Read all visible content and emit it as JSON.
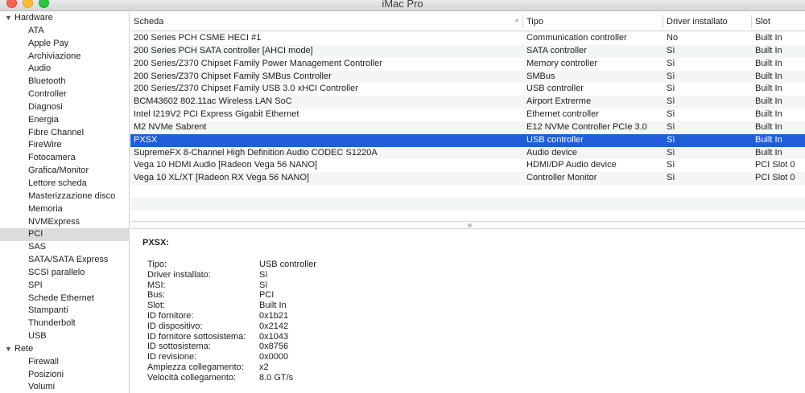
{
  "window": {
    "title": "iMac Pro"
  },
  "sidebar": {
    "groups": [
      {
        "label": "Hardware",
        "items": [
          "ATA",
          "Apple Pay",
          "Archiviazione",
          "Audio",
          "Bluetooth",
          "Controller",
          "Diagnosi",
          "Energia",
          "Fibre Channel",
          "FireWire",
          "Fotocamera",
          "Grafica/Monitor",
          "Lettore scheda",
          "Masterizzazione disco",
          "Memoria",
          "NVMExpress",
          "PCI",
          "SAS",
          "SATA/SATA Express",
          "SCSI parallelo",
          "SPI",
          "Schede Ethernet",
          "Stampanti",
          "Thunderbolt",
          "USB"
        ]
      },
      {
        "label": "Rete",
        "items": [
          "Firewall",
          "Posizioni",
          "Volumi"
        ]
      }
    ],
    "selected": "PCI"
  },
  "table": {
    "columns": [
      "Scheda",
      "Tipo",
      "Driver installato",
      "Slot"
    ],
    "sort_indicator": "^",
    "rows": [
      [
        "200 Series PCH CSME HECI #1",
        "Communication controller",
        "No",
        "Built In"
      ],
      [
        "200 Series PCH SATA controller [AHCI mode]",
        "SATA controller",
        "Sì",
        "Built In"
      ],
      [
        "200 Series/Z370 Chipset Family Power Management Controller",
        "Memory controller",
        "Sì",
        "Built In"
      ],
      [
        "200 Series/Z370 Chipset Family SMBus Controller",
        "SMBus",
        "Sì",
        "Built In"
      ],
      [
        "200 Series/Z370 Chipset Family USB 3.0 xHCI Controller",
        "USB controller",
        "Sì",
        "Built In"
      ],
      [
        "BCM43602 802.11ac Wireless LAN SoC",
        "Airport Extrerme",
        "Sì",
        "Built In"
      ],
      [
        "Intel I219V2 PCI Express Gigabit Ethernet",
        "Ethernet controller",
        "Sì",
        "Built In"
      ],
      [
        "M2 NVMe Sabrent",
        "E12 NVMe Controller PCIe 3.0",
        "Sì",
        "Built In"
      ],
      [
        "PXSX",
        "USB controller",
        "Sì",
        "Built In"
      ],
      [
        "SupremeFX 8-Channel High Definition Audio CODEC S1220A",
        "Audio device",
        "Sì",
        "Built In"
      ],
      [
        "Vega 10 HDMI Audio [Radeon Vega 56 NANO]",
        "HDMI/DP Audio device",
        "Sì",
        "PCI Slot 0"
      ],
      [
        "Vega 10 XL/XT [Radeon RX Vega 56 NANO]",
        "Controller Monitor",
        "Sì",
        "PCI Slot 0"
      ]
    ],
    "selected_index": 8
  },
  "detail": {
    "title": "PXSX:",
    "fields": [
      {
        "label": "Tipo:",
        "value": "USB controller"
      },
      {
        "label": "Driver installato:",
        "value": "Sì"
      },
      {
        "label": "MSI:",
        "value": "Sì"
      },
      {
        "label": "Bus:",
        "value": "PCI"
      },
      {
        "label": "Slot:",
        "value": "Built In"
      },
      {
        "label": "ID fornitore:",
        "value": "0x1b21"
      },
      {
        "label": "ID dispositivo:",
        "value": "0x2142"
      },
      {
        "label": "ID fornitore sottosistema:",
        "value": "0x1043"
      },
      {
        "label": "ID sottosistema:",
        "value": "0x8756"
      },
      {
        "label": "ID revisione:",
        "value": "0x0000"
      },
      {
        "label": "Ampiezza collegamento:",
        "value": "x2"
      },
      {
        "label": "Velocità collegamento:",
        "value": "8.0 GT/s"
      }
    ]
  },
  "colors": {
    "selection": "#1f5ed6",
    "sidebar_selection": "#dcdcdc",
    "row_alt": "#f4f5f5",
    "close": "#fe5f57",
    "minimize": "#febc2e",
    "zoom": "#28c840"
  }
}
